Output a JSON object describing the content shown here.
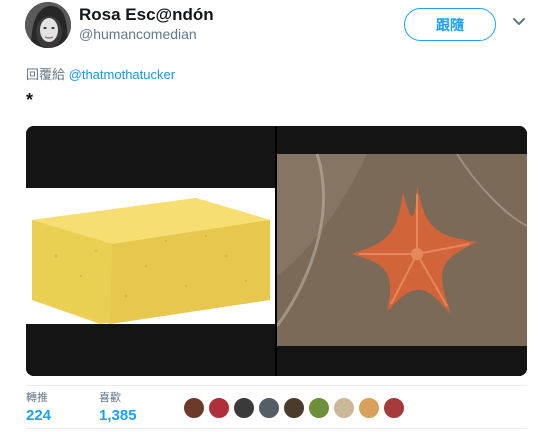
{
  "author": {
    "name": "Rosa Esc@ndón",
    "handle": "@humancomedian"
  },
  "follow_label": "跟隨",
  "reply": {
    "prefix": "回覆給",
    "to": "@thatmothatucker"
  },
  "tweet_text": "*",
  "media": {
    "left": "sponge",
    "right": "starfish"
  },
  "stats": {
    "retweets_label": "轉推",
    "retweets_value": "224",
    "likes_label": "喜歡",
    "likes_value": "1,385"
  },
  "likers": [
    {
      "color": "#6b3a2a"
    },
    {
      "color": "#b0303a"
    },
    {
      "color": "#3a3a3a"
    },
    {
      "color": "#555d66"
    },
    {
      "color": "#4a3b2a"
    },
    {
      "color": "#6f8f3a"
    },
    {
      "color": "#c9b89a"
    },
    {
      "color": "#d9a05a"
    },
    {
      "color": "#a43a3a"
    }
  ],
  "colors": {
    "accent": "#1da1f2",
    "secondary_text": "#657786"
  }
}
